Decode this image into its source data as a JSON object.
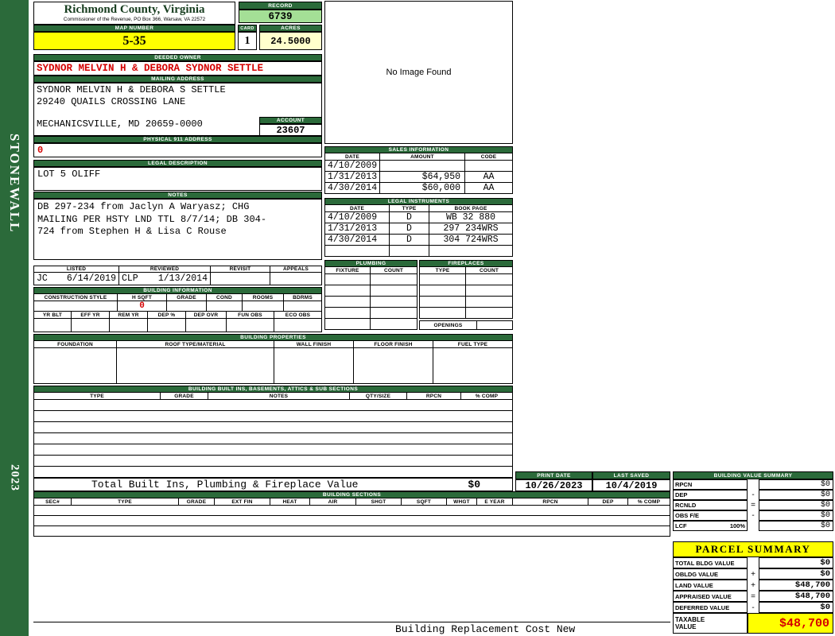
{
  "colors": {
    "section_bar_green": "#2b6a3a",
    "highlight_yellow": "#ffff00",
    "value_cream": "#ffffcc",
    "record_green": "#a4df96",
    "alert_red": "#d40000"
  },
  "sidebar": {
    "district": "STONEWALL",
    "year": "2023"
  },
  "header": {
    "county": "Richmond County, Virginia",
    "office_line": "Commissioner of the Revenue, PO Box 366, Warsaw, VA 22572",
    "record_label": "RECORD",
    "record_value": "6739",
    "map_number_label": "MAP NUMBER",
    "map_number_value": "5-35",
    "card_label": "CARD",
    "card_value": "1",
    "acres_label": "ACRES",
    "acres_value": "24.5000"
  },
  "owner": {
    "deeded_owner_label": "DEEDED OWNER",
    "deeded_owner": "SYDNOR MELVIN H & DEBORA SYDNOR SETTLE",
    "mailing_address_label": "MAILING ADDRESS",
    "mailing_line1": "SYDNOR MELVIN H & DEBORA S SETTLE",
    "mailing_line2": "29240 QUAILS CROSSING LANE",
    "mailing_line3": "MECHANICSVILLE, MD 20659-0000",
    "account_label": "ACCOUNT",
    "account_number": "23607",
    "physical_911_label": "PHYSICAL 911 ADDRESS",
    "physical_911_value": "0"
  },
  "legal_description": {
    "label": "LEGAL DESCRIPTION",
    "value": "LOT 5 OLIFF"
  },
  "notes": {
    "label": "NOTES",
    "line1": "DB 297-234 from Jaclyn A Waryasz; CHG",
    "line2": "MAILING PER HSTY LND TTL 8/7/14; DB 304-",
    "line3": "724 from Stephen H & Lisa C Rouse"
  },
  "photo": {
    "placeholder": "No Image Found"
  },
  "sales_information": {
    "title": "SALES INFORMATION",
    "headers": [
      "DATE",
      "AMOUNT",
      "CODE"
    ],
    "rows": [
      {
        "date": "4/10/2009",
        "amount": "",
        "code": ""
      },
      {
        "date": "1/31/2013",
        "amount": "$64,950",
        "code": "AA"
      },
      {
        "date": "4/30/2014",
        "amount": "$60,000",
        "code": "AA"
      }
    ]
  },
  "legal_instruments": {
    "title": "LEGAL INSTRUMENTS",
    "headers": [
      "DATE",
      "TYPE",
      "BOOK PAGE"
    ],
    "rows": [
      {
        "date": "4/10/2009",
        "type": "D",
        "book_page": "WB 32 880"
      },
      {
        "date": "1/31/2013",
        "type": "D",
        "book_page": "297 234WRS"
      },
      {
        "date": "4/30/2014",
        "type": "D",
        "book_page": "304 724WRS"
      }
    ]
  },
  "plumbing": {
    "title": "PLUMBING",
    "headers": [
      "FIXTURE",
      "COUNT"
    ]
  },
  "fireplaces": {
    "title": "FIREPLACES",
    "headers": [
      "TYPE",
      "COUNT"
    ],
    "openings_label": "OPENINGS"
  },
  "review": {
    "listed_label": "LISTED",
    "reviewed_label": "REVIEWED",
    "revisit_label": "REVISIT",
    "appeals_label": "APPEALS",
    "listed_by": "JC",
    "listed_date": "6/14/2019",
    "reviewed_by": "CLP",
    "reviewed_date": "1/13/2014"
  },
  "building_information": {
    "title": "BUILDING INFORMATION",
    "row1_headers": [
      "CONSTRUCTION STYLE",
      "H SQFT",
      "GRADE",
      "COND",
      "ROOMS",
      "BDRMS"
    ],
    "h_sqft": "0",
    "row2_headers": [
      "YR BLT",
      "EFF YR",
      "REM YR",
      "DEP %",
      "DEP OVR",
      "FUN OBS",
      "ECO OBS"
    ]
  },
  "building_properties": {
    "title": "BUILDING PROPERTIES",
    "headers": [
      "FOUNDATION",
      "ROOF TYPE/MATERIAL",
      "WALL FINISH",
      "FLOOR FINISH",
      "FUEL TYPE"
    ]
  },
  "built_ins": {
    "title": "BUILDING BUILT INS, BASEMENTS, ATTICS & SUB SECTIONS",
    "headers": [
      "TYPE",
      "GRADE",
      "NOTES",
      "QTY/SIZE",
      "RPCN",
      "% COMP"
    ],
    "total_label": "Total Built Ins, Plumbing & Fireplace Value",
    "total_value": "$0"
  },
  "print_info": {
    "print_date_label": "PRINT DATE",
    "print_date": "10/26/2023",
    "last_saved_label": "LAST SAVED",
    "last_saved": "10/4/2019"
  },
  "building_value_summary": {
    "title": "BUILDING VALUE SUMMARY",
    "rows": [
      {
        "label": "RPCN",
        "op": "",
        "value": "$0"
      },
      {
        "label": "DEP",
        "op": "-",
        "value": "$0"
      },
      {
        "label": "RCNLD",
        "op": "=",
        "value": "$0"
      },
      {
        "label": "OBS F/E",
        "op": "-",
        "value": "$0"
      },
      {
        "label": "LCF",
        "sub": "100%",
        "op": "",
        "value": "$0"
      }
    ]
  },
  "building_sections": {
    "title": "BUILDING SECTIONS",
    "headers": [
      "SEC#",
      "TYPE",
      "GRADE",
      "EXT FIN",
      "HEAT",
      "AIR",
      "SHGT",
      "SQFT",
      "WHGT",
      "E YEAR",
      "RPCN",
      "DEP",
      "% COMP"
    ]
  },
  "parcel_summary": {
    "title": "PARCEL SUMMARY",
    "rows": [
      {
        "label": "TOTAL BLDG VALUE",
        "op": "",
        "value": "$0"
      },
      {
        "label": "OBLDG VALUE",
        "op": "+",
        "value": "$0"
      },
      {
        "label": "LAND VALUE",
        "op": "+",
        "value": "$48,700"
      },
      {
        "label": "APPRAISED VALUE",
        "op": "=",
        "value": "$48,700"
      },
      {
        "label": "DEFERRED VALUE",
        "op": "-",
        "value": "$0"
      }
    ],
    "taxable_label_line1": "TAXABLE",
    "taxable_label_line2": "VALUE",
    "taxable_value": "$48,700"
  },
  "footer": {
    "note": "Building Replacement Cost New"
  }
}
